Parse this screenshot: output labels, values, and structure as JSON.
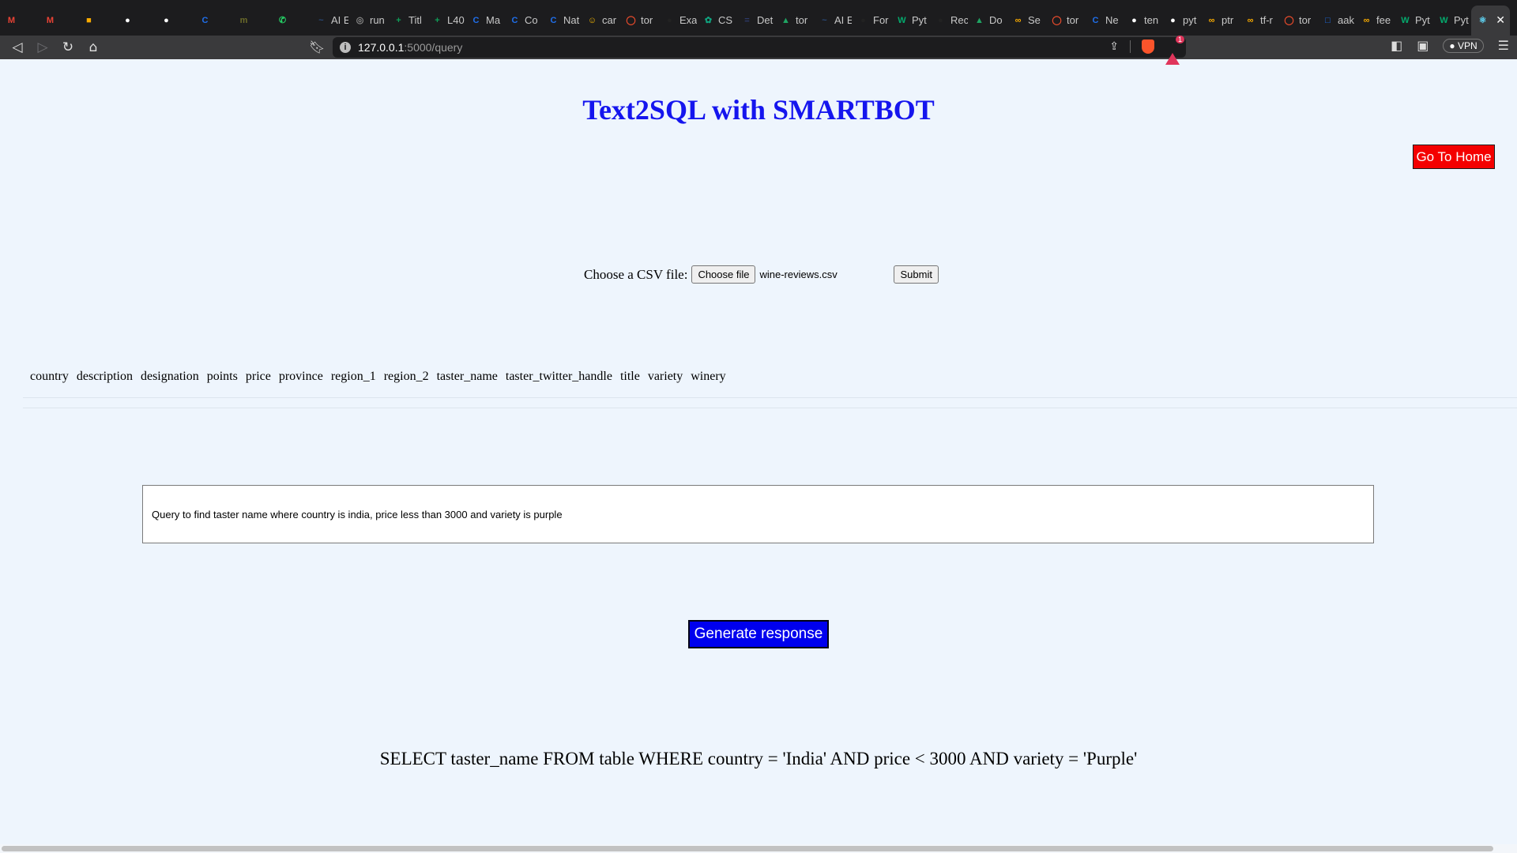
{
  "browser": {
    "tabs": [
      {
        "label": "",
        "icon": "gmail-icon",
        "color": "#ea4335",
        "glyph": "M"
      },
      {
        "label": "",
        "icon": "gmail-icon",
        "color": "#ea4335",
        "glyph": "M"
      },
      {
        "label": "",
        "icon": "notes-icon",
        "color": "#f9ab00",
        "glyph": "■"
      },
      {
        "label": "",
        "icon": "github-icon",
        "color": "#ffffff",
        "glyph": "●"
      },
      {
        "label": "",
        "icon": "github-icon",
        "color": "#ffffff",
        "glyph": "●"
      },
      {
        "label": "",
        "icon": "coursera-icon",
        "color": "#1f6feb",
        "glyph": "C"
      },
      {
        "label": "",
        "icon": "mt-icon",
        "color": "#6b6b2a",
        "glyph": "m"
      },
      {
        "label": "",
        "icon": "whatsapp-icon",
        "color": "#25d366",
        "glyph": "✆"
      },
      {
        "label": "AI E",
        "icon": "site-icon",
        "color": "#2a4a7a",
        "glyph": "~"
      },
      {
        "label": "run",
        "icon": "globe-icon",
        "color": "#888888",
        "glyph": "◎"
      },
      {
        "label": "Titl",
        "icon": "sheets-icon",
        "color": "#0f9d58",
        "glyph": "+"
      },
      {
        "label": "L40",
        "icon": "sheets-icon",
        "color": "#0f9d58",
        "glyph": "+"
      },
      {
        "label": "Ma",
        "icon": "coursera-icon",
        "color": "#1f6feb",
        "glyph": "C"
      },
      {
        "label": "Co",
        "icon": "coursera-icon",
        "color": "#1f6feb",
        "glyph": "C"
      },
      {
        "label": "Nat",
        "icon": "coursera-icon",
        "color": "#1f6feb",
        "glyph": "C"
      },
      {
        "label": "car",
        "icon": "hf-icon",
        "color": "#f5b700",
        "glyph": "☺"
      },
      {
        "label": "tor",
        "icon": "pytorch-icon",
        "color": "#ee4c2c",
        "glyph": "◯"
      },
      {
        "label": "Exa",
        "icon": "site-icon",
        "color": "#222222",
        "glyph": "●"
      },
      {
        "label": "CS",
        "icon": "chatgpt-icon",
        "color": "#10a37f",
        "glyph": "✿"
      },
      {
        "label": "Det",
        "icon": "site-icon",
        "color": "#2d3b6b",
        "glyph": "="
      },
      {
        "label": "tor",
        "icon": "drive-icon",
        "color": "#1fa463",
        "glyph": "▲"
      },
      {
        "label": "AI E",
        "icon": "site-icon",
        "color": "#2a4a7a",
        "glyph": "~"
      },
      {
        "label": "For",
        "icon": "site-icon",
        "color": "#222222",
        "glyph": "●"
      },
      {
        "label": "Pyt",
        "icon": "w3-icon",
        "color": "#04aa6d",
        "glyph": "W"
      },
      {
        "label": "Rec",
        "icon": "site-icon",
        "color": "#222222",
        "glyph": "●"
      },
      {
        "label": "Do",
        "icon": "drive-icon",
        "color": "#1fa463",
        "glyph": "▲"
      },
      {
        "label": "Se",
        "icon": "colab-icon",
        "color": "#f9ab00",
        "glyph": "∞"
      },
      {
        "label": "tor",
        "icon": "pytorch-icon",
        "color": "#ee4c2c",
        "glyph": "◯"
      },
      {
        "label": "Ne",
        "icon": "coursera-icon",
        "color": "#1f6feb",
        "glyph": "C"
      },
      {
        "label": "ten",
        "icon": "github-icon",
        "color": "#ffffff",
        "glyph": "●"
      },
      {
        "label": "pyt",
        "icon": "github-icon",
        "color": "#ffffff",
        "glyph": "●"
      },
      {
        "label": "ptr",
        "icon": "colab-icon",
        "color": "#f9ab00",
        "glyph": "∞"
      },
      {
        "label": "tf-r",
        "icon": "colab-icon",
        "color": "#f9ab00",
        "glyph": "∞"
      },
      {
        "label": "tor",
        "icon": "pytorch-icon",
        "color": "#ee4c2c",
        "glyph": "◯"
      },
      {
        "label": "aak",
        "icon": "site-icon",
        "color": "#1f6feb",
        "glyph": "□"
      },
      {
        "label": "fee",
        "icon": "colab-icon",
        "color": "#f9ab00",
        "glyph": "∞"
      },
      {
        "label": "Pyt",
        "icon": "w3-icon",
        "color": "#04aa6d",
        "glyph": "W"
      },
      {
        "label": "Pyt",
        "icon": "w3-icon",
        "color": "#04aa6d",
        "glyph": "W"
      }
    ],
    "active_tab": {
      "icon": "react-icon",
      "color": "#61dafb",
      "glyph": "⚛"
    },
    "url_host": "127.0.0.1",
    "url_path": ":5000/query",
    "vpn_label": "VPN",
    "rewards_badge": "1"
  },
  "page": {
    "title": "Text2SQL with SMARTBOT",
    "home_button": "Go To Home",
    "upload_label": "Choose a CSV file:",
    "choose_file_button": "Choose file",
    "file_name": "wine-reviews.csv",
    "submit_button": "Submit",
    "columns": [
      "country",
      "description",
      "designation",
      "points",
      "price",
      "province",
      "region_1",
      "region_2",
      "taster_name",
      "taster_twitter_handle",
      "title",
      "variety",
      "winery"
    ],
    "query_text": "Query to find taster name where country is india, price less than 3000 and variety is purple",
    "generate_button": "Generate response",
    "result_sql": "SELECT taster_name FROM table WHERE country = 'India' AND price < 3000 AND variety = 'Purple'"
  }
}
